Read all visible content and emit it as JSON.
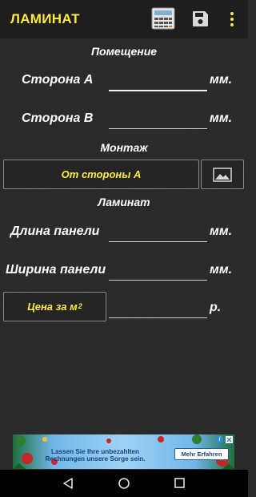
{
  "app": {
    "title": "ЛАМИНАТ"
  },
  "toolbar": {
    "calculator_icon": "calculator-icon",
    "save_icon": "floppy-disk-icon",
    "menu_icon": "more-vert-icon"
  },
  "room": {
    "section_title": "Помещение",
    "side_a_label": "Сторона А",
    "side_a_value": "",
    "side_a_unit": "мм.",
    "side_b_label": "Сторона В",
    "side_b_value": "",
    "side_b_unit": "мм."
  },
  "mounting": {
    "section_title": "Монтаж",
    "direction_button": "От стороны А",
    "image_button_icon": "image-icon"
  },
  "laminate": {
    "section_title": "Ламинат",
    "panel_length_label": "Длина панели",
    "panel_length_value": "",
    "panel_length_unit": "мм.",
    "panel_width_label": "Ширина панели",
    "panel_width_value": "",
    "panel_width_unit": "мм.",
    "price_button_text": "Цена за м",
    "price_button_sup": "2",
    "price_value": "",
    "price_unit": "р."
  },
  "ad": {
    "line1": "Lassen Sie Ihre unbezahlten",
    "line2": "Rechnungen  unsere Sorge sein.",
    "cta": "Mehr Erfahren",
    "info_icon": "info-icon",
    "close_icon": "close-icon"
  },
  "navbar": {
    "back_icon": "back-triangle-icon",
    "home_icon": "home-circle-icon",
    "recents_icon": "recents-square-icon"
  },
  "colors": {
    "accent": "#ffeb3b",
    "appbar": "#1e1e1e",
    "background": "#2a2a2a",
    "navbar": "#000000"
  }
}
